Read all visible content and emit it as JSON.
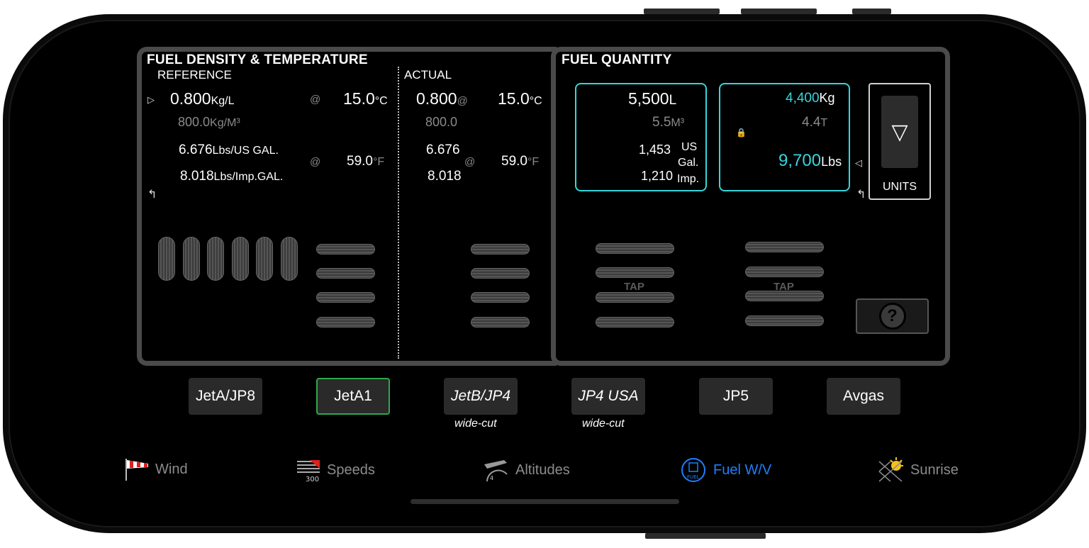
{
  "density": {
    "title": "FUEL DENSITY & TEMPERATURE",
    "reference_label": "REFERENCE",
    "actual_label": "ACTUAL",
    "ref": {
      "kgl": "0.800",
      "kgl_unit": "Kg/L",
      "kgm3": "800.0",
      "kgm3_unit": "Kg/M³",
      "lbs_us": "6.676",
      "lbs_us_unit": "Lbs/US GAL.",
      "lbs_imp": "8.018",
      "lbs_imp_unit": "Lbs/Imp.GAL.",
      "at": "@",
      "temp_c": "15.0",
      "temp_c_unit": "°C",
      "temp_f": "59.0",
      "temp_f_unit": "°F"
    },
    "act": {
      "kgl": "0.800",
      "kgm3": "800.0",
      "lbs_us": "6.676",
      "lbs_imp": "8.018",
      "at": "@",
      "temp_c": "15.0",
      "temp_c_unit": "°C",
      "temp_f": "59.0",
      "temp_f_unit": "°F"
    }
  },
  "quantity": {
    "title": "FUEL QUANTITY",
    "vol": {
      "liters": "5,500",
      "liters_unit": "L",
      "m3": "5.5",
      "m3_unit": "M³",
      "us_gal": "1,453",
      "us_gal_unit_1": "US",
      "us_gal_unit_2": "Gal.",
      "imp_gal": "1,210",
      "imp_gal_unit": "Imp."
    },
    "mass": {
      "kg": "4,400",
      "kg_unit": "Kg",
      "t": "4.4",
      "t_unit": "T",
      "lbs": "9,700",
      "lbs_unit": "Lbs"
    },
    "units_label": "UNITS",
    "tap_label": "TAP",
    "help_label": "?"
  },
  "fuel_types": [
    {
      "label": "JetA/JP8",
      "sub": ""
    },
    {
      "label": "JetA1",
      "sub": ""
    },
    {
      "label": "JetB/JP4",
      "sub": "wide-cut"
    },
    {
      "label": "JP4 USA",
      "sub": "wide-cut"
    },
    {
      "label": "JP5",
      "sub": ""
    },
    {
      "label": "Avgas",
      "sub": ""
    }
  ],
  "tabs": [
    {
      "label": "Wind",
      "icon": "windsock-icon"
    },
    {
      "label": "Speeds",
      "icon": "speed-dial-icon"
    },
    {
      "label": "Altitudes",
      "icon": "altimeter-icon"
    },
    {
      "label": "Fuel W/V",
      "icon": "fuel-icon"
    },
    {
      "label": "Sunrise",
      "icon": "sun-icon"
    }
  ],
  "colors": {
    "accent": "#1e7fff",
    "cyan": "#35d6dc",
    "selected": "#2fa84a"
  }
}
